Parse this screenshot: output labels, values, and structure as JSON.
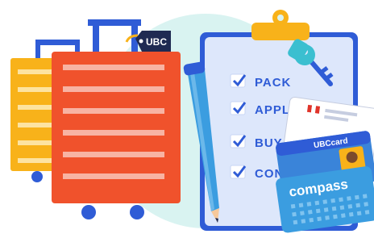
{
  "tag": {
    "text": "UBC"
  },
  "checklist": {
    "items": [
      {
        "label": "PACK"
      },
      {
        "label": "APPL"
      },
      {
        "label": "BUY"
      },
      {
        "label": "CON"
      }
    ]
  },
  "ubc_card": {
    "label": "UBCcard"
  },
  "compass_card": {
    "label": "compass"
  },
  "colors": {
    "backdrop": "#d9f3f1",
    "suitcase_yellow": "#f8b21a",
    "suitcase_red": "#f0522c",
    "handle_blue": "#2f5cd6",
    "clipboard": "#dde7fb",
    "check_blue": "#2f5cd6",
    "clip_yellow": "#f8b21a",
    "key_teal": "#3bbfd0",
    "pencil_blue": "#3b9de0",
    "card_blue": "#3a84d9",
    "compass_blue": "#3b9de0",
    "tag_navy": "#1f2a52"
  },
  "icons": [
    "suitcase-icon",
    "luggage-tag-icon",
    "clipboard-icon",
    "checkmark-icon",
    "key-icon",
    "pencil-icon",
    "id-card-icon",
    "transit-card-icon"
  ]
}
